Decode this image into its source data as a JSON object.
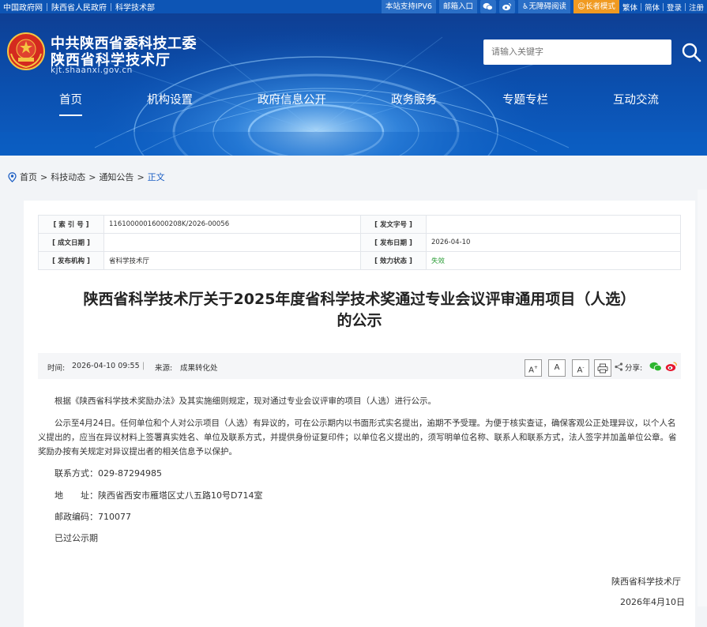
{
  "topbar": {
    "links": [
      "中国政府网",
      "陕西省人民政府",
      "科学技术部"
    ],
    "ipv6": "本站支持IPV6",
    "mail": "邮箱入口",
    "accessible": "无障碍阅读",
    "elder": "长者模式",
    "traditional": "繁体",
    "simplified": "简体",
    "login": "登录",
    "register": "注册"
  },
  "header": {
    "title1": "中共陕西省委科技工委",
    "title2": "陕西省科学技术厅",
    "domain": "kjt.shaanxi.gov.cn",
    "search_placeholder": "请输入关键字"
  },
  "nav": [
    "首页",
    "机构设置",
    "政府信息公开",
    "政务服务",
    "专题专栏",
    "互动交流"
  ],
  "breadcrumb": [
    "首页",
    ">",
    "科技动态",
    ">",
    "通知公告",
    ">",
    "正文"
  ],
  "meta": {
    "index_label": "[ 索 引 号 ]",
    "index_value": "11610000016000208K/2026-00056",
    "docno_label": "[ 发文字号 ]",
    "docno_value": "",
    "date_label": "[ 成文日期 ]",
    "date_value": "",
    "pubdate_label": "[ 发布日期 ]",
    "pubdate_value": "2026-04-10",
    "org_label": "[ 发布机构 ]",
    "org_value": "省科学技术厅",
    "status_label": "[ 效力状态 ]",
    "status_value": "失效"
  },
  "article": {
    "title_line1": "陕西省科学技术厅关于2025年度省科学技术奖通过专业会议评审通用项目（人选）",
    "title_line2": "的公示",
    "time_label": "时间:",
    "time_value": "2026-04-10 09:55",
    "divider": "|",
    "source_label": "来源:",
    "source_value": "成果转化处",
    "font_large": "A",
    "font_medium": "A",
    "font_small": "A",
    "share_label": "分享:",
    "para1": "根据《陕西省科学技术奖励办法》及其实施细则规定，现对通过专业会议评审的项目（人选）进行公示。",
    "para2": "公示至4月24日。任何单位和个人对公示项目（人选）有异议的，可在公示期内以书面形式实名提出，逾期不予受理。为便于核实查证，确保客观公正处理异议，以个人名义提出的，应当在异议材料上签署真实姓名、单位及联系方式，并提供身份证复印件；以单位名义提出的，须写明单位名称、联系人和联系方式，法人签字并加盖单位公章。省奖励办按有关规定对异议提出者的相关信息予以保护。",
    "contact": "联系方式：029-87294985",
    "address": "地　　址：陕西省西安市雁塔区丈八五路10号D714室",
    "postcode": "邮政编码：710077",
    "expired": "已过公示期",
    "signer": "陕西省科学技术厅",
    "sign_date": "2026年4月10日"
  },
  "colors": {
    "brand": "#0d55b5",
    "accent": "#f09a21",
    "link": "#1d5fc4",
    "status_green": "#2e9e3a"
  }
}
